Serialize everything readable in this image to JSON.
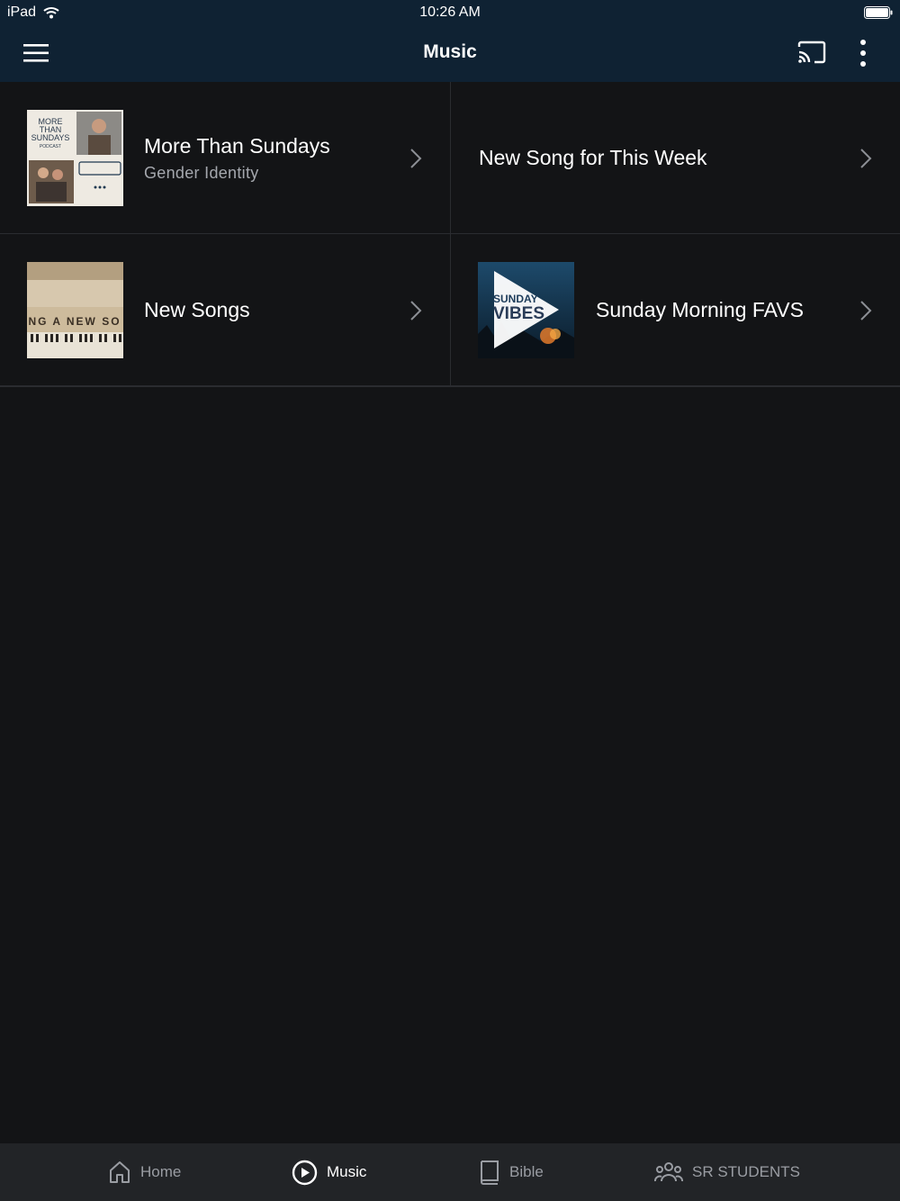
{
  "status_bar": {
    "device": "iPad",
    "time": "10:26 AM",
    "wifi_icon": "wifi-icon",
    "battery_icon": "battery-icon"
  },
  "header": {
    "title": "Music",
    "menu_icon": "hamburger-menu-icon",
    "cast_icon": "cast-icon",
    "more_icon": "more-vertical-icon",
    "background_color": "#0f2233"
  },
  "items": [
    {
      "title": "More Than Sundays",
      "subtitle": "Gender Identity",
      "thumbnail": "more-than-sundays-podcast-artwork",
      "thumb_text": [
        "MORE",
        "THAN",
        "SUNDAYS",
        "PODCAST"
      ]
    },
    {
      "title": "New Song for This Week",
      "subtitle": ""
    },
    {
      "title": "New Songs",
      "subtitle": "",
      "thumbnail": "piano-artwork",
      "thumb_text": "NG A NEW SO"
    },
    {
      "title": "Sunday Morning FAVS",
      "subtitle": "",
      "thumbnail": "sunday-vibes-artwork",
      "thumb_text": [
        "SUNDAY",
        "VIBES"
      ]
    }
  ],
  "tab_bar": {
    "tabs": [
      {
        "label": "Home",
        "icon": "home-icon",
        "active": false
      },
      {
        "label": "Music",
        "icon": "play-circle-icon",
        "active": true
      },
      {
        "label": "Bible",
        "icon": "book-icon",
        "active": false
      },
      {
        "label": "SR STUDENTS",
        "icon": "group-icon",
        "active": false
      }
    ]
  },
  "colors": {
    "background": "#131416",
    "divider": "#2a2c30",
    "tab_bar": "#222427",
    "inactive_tab": "#9a9da3"
  }
}
